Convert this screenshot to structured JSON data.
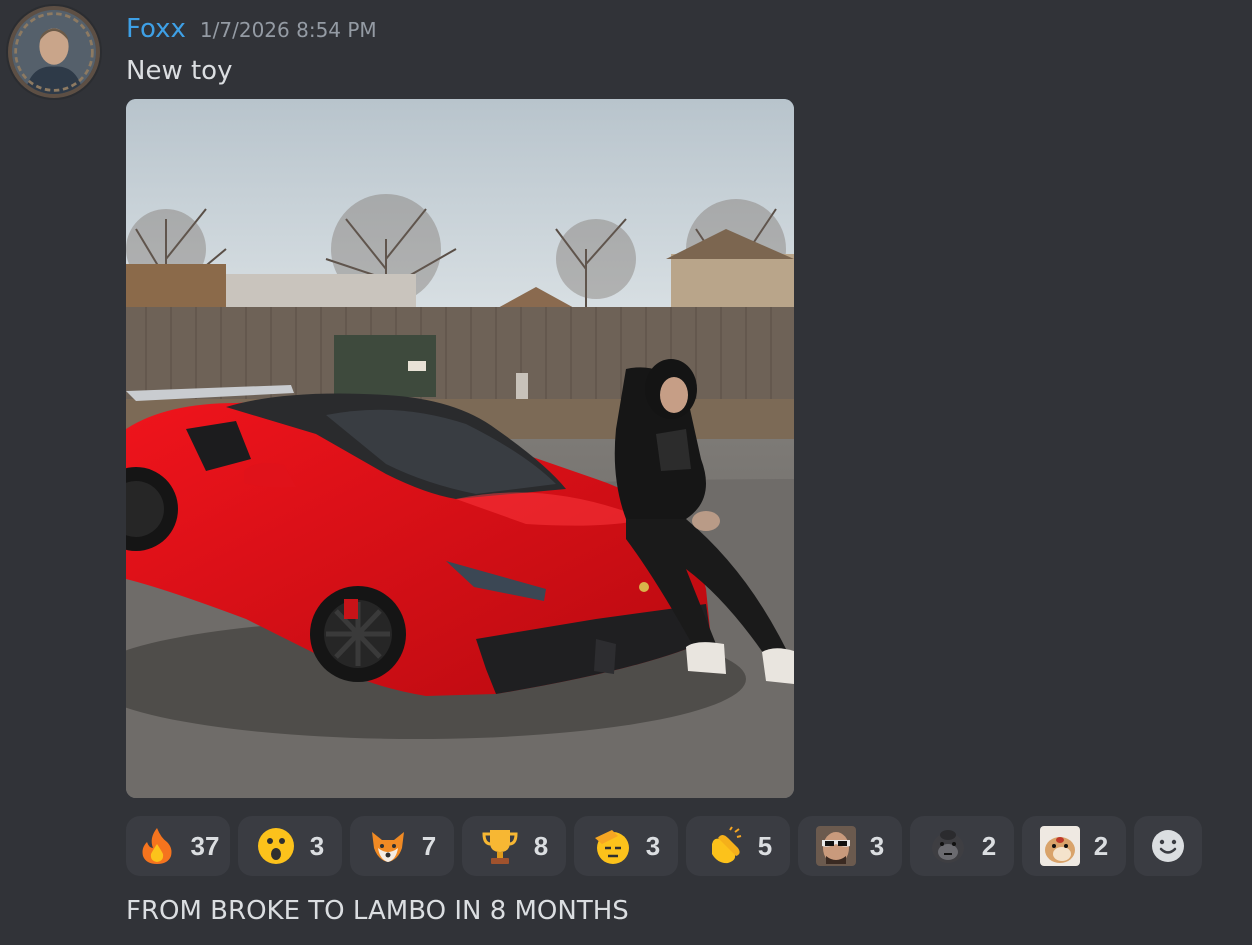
{
  "message": {
    "author": "Foxx",
    "timestamp": "1/7/2026 8:54 PM",
    "text": "New toy",
    "attachment": {
      "type": "image",
      "description_icon": "photo-red-sports-car"
    }
  },
  "reactions": [
    {
      "emoji": "fire-emoji",
      "count": "37"
    },
    {
      "emoji": "surprised-face-emoji",
      "count": "3"
    },
    {
      "emoji": "fox-emoji",
      "count": "7"
    },
    {
      "emoji": "trophy-emoji",
      "count": "8"
    },
    {
      "emoji": "saluting-face-emoji",
      "count": "3"
    },
    {
      "emoji": "clapping-hands-emoji",
      "count": "5"
    },
    {
      "emoji": "custom-sunglasses-face-emoji",
      "count": "3"
    },
    {
      "emoji": "gorilla-emoji",
      "count": "2"
    },
    {
      "emoji": "custom-hamster-emoji",
      "count": "2"
    }
  ],
  "add_reaction_icon": "add-reaction-smiley-icon",
  "followup_message": {
    "text": "FROM BROKE TO LAMBO IN 8 MONTHS"
  },
  "colors": {
    "background": "#313338",
    "username": "#3ea0e6",
    "timestamp": "#949ba4",
    "text": "#dbdee1",
    "reaction_bg": "#3a3c42"
  }
}
